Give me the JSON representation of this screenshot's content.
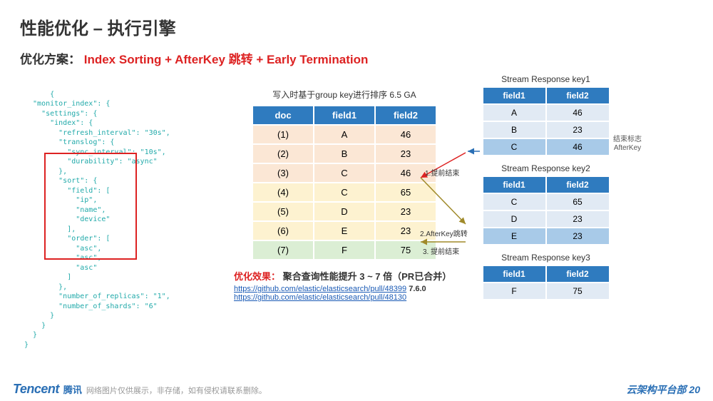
{
  "title": "性能优化 – 执行引擎",
  "subtitle_black": "优化方案：",
  "subtitle_red": "Index Sorting + AfterKey 跳转 + Early Termination",
  "code_lines": "{\n  \"monitor_index\": {\n    \"settings\": {\n      \"index\": {\n        \"refresh_interval\": \"30s\",\n        \"translog\": {\n          \"sync_interval\": \"10s\",\n          \"durability\": \"async\"\n        },\n        \"sort\": {\n          \"field\": [\n            \"ip\",\n            \"name\",\n            \"device\"\n          ],\n          \"order\": [\n            \"asc\",\n            \"asc\",\n            \"asc\"\n          ]\n        },\n        \"number_of_replicas\": \"1\",\n        \"number_of_shards\": \"6\"\n      }\n    }\n  }\n}",
  "mid_caption": "写入时基于group key进行排序  6.5 GA",
  "chart_data": {
    "type": "table",
    "main": {
      "headers": [
        "doc",
        "field1",
        "field2"
      ],
      "rows": [
        [
          "(1)",
          "A",
          "46"
        ],
        [
          "(2)",
          "B",
          "23"
        ],
        [
          "(3)",
          "C",
          "46"
        ],
        [
          "(4)",
          "C",
          "65"
        ],
        [
          "(5)",
          "D",
          "23"
        ],
        [
          "(6)",
          "E",
          "23"
        ],
        [
          "(7)",
          "F",
          "75"
        ]
      ]
    },
    "streams": [
      {
        "title": "Stream Response key1",
        "headers": [
          "field1",
          "field2"
        ],
        "rows": [
          [
            "A",
            "46"
          ],
          [
            "B",
            "23"
          ],
          [
            "C",
            "46"
          ]
        ],
        "highlight_idx": 2
      },
      {
        "title": "Stream Response key2",
        "headers": [
          "field1",
          "field2"
        ],
        "rows": [
          [
            "C",
            "65"
          ],
          [
            "D",
            "23"
          ],
          [
            "E",
            "23"
          ]
        ],
        "highlight_idx": 2
      },
      {
        "title": "Stream Response key3",
        "headers": [
          "field1",
          "field2"
        ],
        "rows": [
          [
            "F",
            "75"
          ]
        ]
      }
    ]
  },
  "notes": {
    "end_flag": "结束标志\nAfterKey",
    "a1": "1.提前结束",
    "a2": "2.AfterKey跳转",
    "a3": "3. 提前结束"
  },
  "effect_label": "优化效果：",
  "effect_text": "聚合查询性能提升 3 ~ 7 倍（PR已合并）",
  "links": {
    "l1": "https://github.com/elastic/elasticsearch/pull/48399",
    "v1": "7.6.0",
    "l2": "https://github.com/elastic/elasticsearch/pull/48130"
  },
  "footer": {
    "logo": "Tencent",
    "logo_cn": "腾讯",
    "disclaimer": "网络图片仅供展示，非存储，如有侵权请联系删除。",
    "right": "云架构平台部 20"
  }
}
